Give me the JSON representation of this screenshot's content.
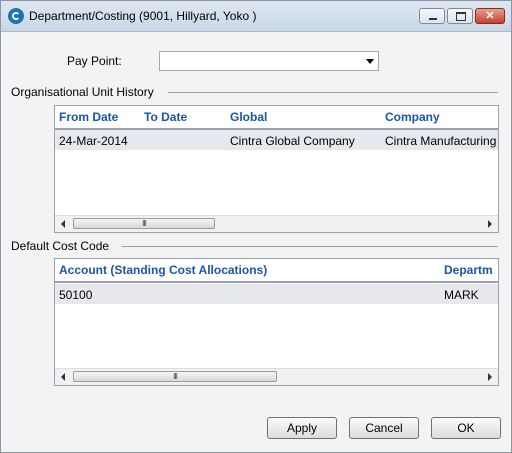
{
  "window": {
    "title": "Department/Costing (9001, Hillyard, Yoko )",
    "close_glyph": "✕"
  },
  "pay_point": {
    "label": "Pay Point:",
    "value": ""
  },
  "org_unit_history": {
    "section_label": "Organisational Unit History",
    "columns": [
      "From Date",
      "To Date",
      "Global",
      "Company"
    ],
    "rows": [
      [
        "24-Mar-2014",
        "",
        "Cintra Global Company",
        "Cintra Manufacturing"
      ]
    ],
    "scroll_thumb_text": "III"
  },
  "default_cost_code": {
    "section_label": "Default Cost Code",
    "columns": [
      "Account (Standing Cost Allocations)",
      "Departm"
    ],
    "rows": [
      [
        "50100",
        "MARK"
      ]
    ],
    "scroll_thumb_text": "III"
  },
  "buttons": {
    "apply": "Apply",
    "cancel": "Cancel",
    "ok": "OK"
  },
  "colors": {
    "header_text": "#1a56a8",
    "selected_row": "#e6e8ee"
  }
}
